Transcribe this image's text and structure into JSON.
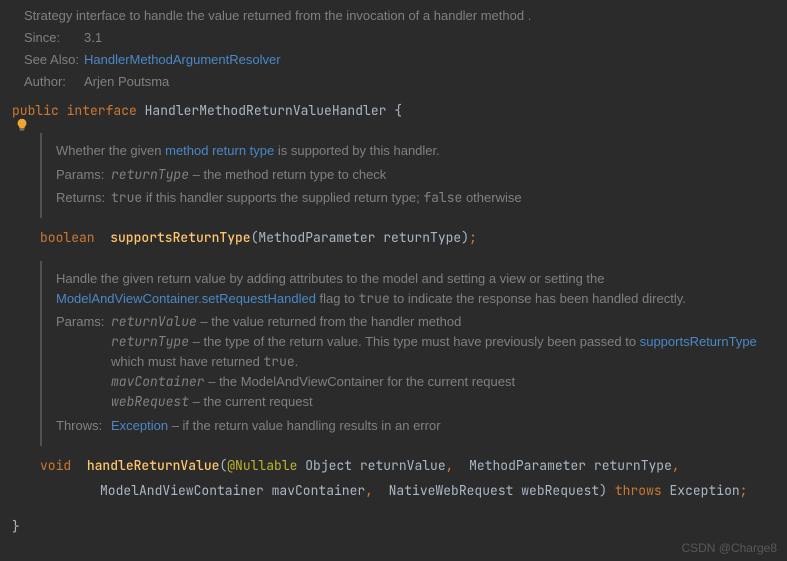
{
  "header": {
    "summary": "Strategy interface to handle the value returned from the invocation of a handler method .",
    "since_label": "Since:",
    "since_value": "3.1",
    "seealso_label": "See Also:",
    "seealso_link": "HandlerMethodArgumentResolver",
    "author_label": "Author:",
    "author_value": "Arjen Poutsma"
  },
  "decl": {
    "kw_public": "public ",
    "kw_interface": "interface ",
    "name": "HandlerMethodReturnValueHandler",
    "brace": " {"
  },
  "m1": {
    "desc_pre": "Whether the given ",
    "desc_link": "method return type",
    "desc_post": " is supported by this handler.",
    "params_label": "Params:",
    "p1_name": "returnType",
    "p1_desc": " – the method return type to check",
    "returns_label": "Returns:",
    "returns_pre": " ",
    "returns_true": "true",
    "returns_mid": " if this handler supports the supplied return type; ",
    "returns_false": "false",
    "returns_post": " otherwise",
    "sig_ret": "boolean  ",
    "sig_name": "supportsReturnType",
    "sig_open": "(",
    "sig_ptype": "MethodParameter ",
    "sig_pname": "returnType",
    "sig_close": ")",
    "sig_semi": ";"
  },
  "m2": {
    "desc1": "Handle the given return value by adding attributes to the model and setting a view or setting the ",
    "desc_link": "ModelAndViewContainer.setRequestHandled",
    "desc2": " flag to ",
    "desc_true": "true",
    "desc3": " to indicate the response has been handled directly.",
    "params_label": "Params:",
    "p1_name": "returnValue",
    "p1_desc": " – the value returned from the handler method",
    "p2_name": "returnType",
    "p2_desc_a": " – the type of the return value. This type must have previously been passed to ",
    "p2_link": "supportsReturnType",
    "p2_desc_b": " which must have returned ",
    "p2_true": "true",
    "p2_dot": ".",
    "p3_name": "mavContainer",
    "p3_desc": " – the ModelAndViewContainer for the current request",
    "p4_name": "webRequest",
    "p4_desc": " – the current request",
    "throws_label": "Throws:",
    "throws_type": "Exception",
    "throws_desc": " – if the return value handling results in an error",
    "sig_ret": "void  ",
    "sig_name": "handleReturnValue",
    "sig_open": "(",
    "sig_anno": "@Nullable",
    "sig_sp": " ",
    "sig_p1t": "Object ",
    "sig_p1n": "returnValue",
    "c1": ",  ",
    "sig_p2t": "MethodParameter ",
    "sig_p2n": "returnType",
    "c2": ",",
    "sig_p3t": "ModelAndViewContainer ",
    "sig_p3n": "mavContainer",
    "c3": ",  ",
    "sig_p4t": "NativeWebRequest ",
    "sig_p4n": "webRequest",
    "sig_close": ")",
    "kw_throws": " throws ",
    "throws_t": "Exception",
    "sig_semi": ";"
  },
  "close_brace": "}",
  "watermark": "CSDN @Charge8"
}
